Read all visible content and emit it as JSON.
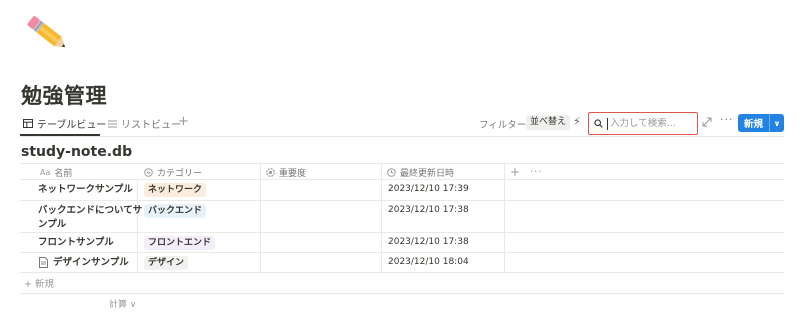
{
  "page": {
    "icon": "pencil-emoji",
    "title": "勉強管理"
  },
  "views": {
    "tabs": [
      {
        "label": "テーブルビュー",
        "icon": "table-icon",
        "active": true
      },
      {
        "label": "リストビュー",
        "icon": "list-icon",
        "active": false
      }
    ],
    "add_view": "+"
  },
  "toolbar": {
    "filter_label": "フィルター",
    "sort_label": "並べ替え",
    "search_placeholder": "入力して検索...",
    "more": "···",
    "new_label": "新規",
    "new_chevron": "∨"
  },
  "database": {
    "title": "study-note.db",
    "more": "···"
  },
  "columns": {
    "name": {
      "label": "名前",
      "icon_text": "Aa"
    },
    "category": {
      "label": "カテゴリー",
      "icon": "select-icon"
    },
    "importance": {
      "label": "重要度",
      "icon": "status-icon"
    },
    "updated": {
      "label": "最終更新日時",
      "icon": "clock-icon"
    },
    "add": "+",
    "more": "···"
  },
  "rows": [
    {
      "name": "ネットワークサンプル",
      "name_line2": "",
      "has_page_icon": false,
      "category": "ネットワーク",
      "category_color": "#fbecdd",
      "importance": "",
      "updated": "2023/12/10 17:39"
    },
    {
      "name": "バックエンドについてサ",
      "name_line2": "ンプル",
      "has_page_icon": false,
      "category": "バックエンド",
      "category_color": "#e7f3f8",
      "importance": "",
      "updated": "2023/12/10 17:38"
    },
    {
      "name": "フロントサンプル",
      "name_line2": "",
      "has_page_icon": false,
      "category": "フロントエンド",
      "category_color": "#f4eefb",
      "importance": "",
      "updated": "2023/12/10 17:38"
    },
    {
      "name": "デザインサンプル",
      "name_line2": "",
      "has_page_icon": true,
      "category": "デザイン",
      "category_color": "#f1f1ef",
      "importance": "",
      "updated": "2023/12/10 18:04"
    }
  ],
  "footer": {
    "add_new": "+ 新規",
    "calculate": "計算 ∨"
  },
  "colors": {
    "accent": "#2383e2",
    "search_border": "#e2554b",
    "text": "#37352f",
    "muted": "#787774"
  }
}
